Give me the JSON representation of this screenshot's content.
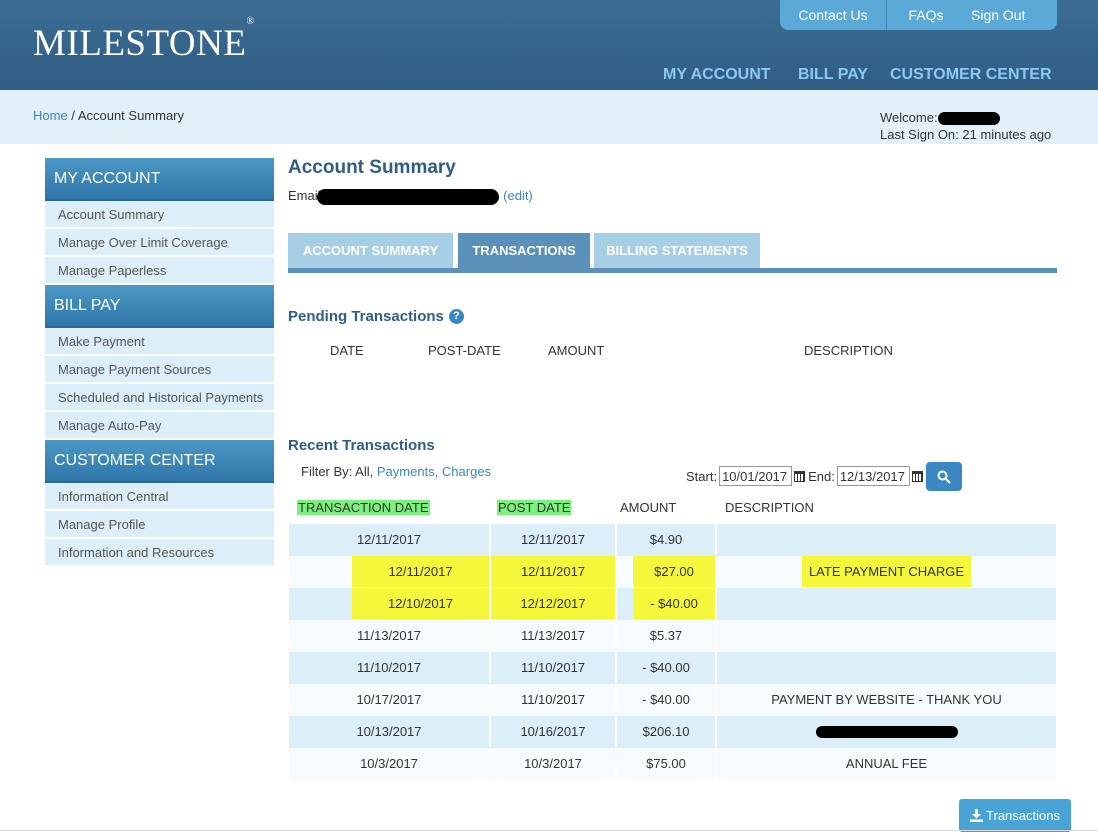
{
  "header": {
    "logo": "MILESTONE",
    "logo_mark": "®",
    "top_links": {
      "contact": "Contact Us",
      "faqs": "FAQs",
      "signout": "Sign Out"
    },
    "nav": {
      "my_account": "MY ACCOUNT",
      "bill_pay": "BILL PAY",
      "customer_center": "CUSTOMER CENTER"
    }
  },
  "breadcrumb": {
    "home": "Home",
    "separator": " / ",
    "current": "Account Summary"
  },
  "welcome": {
    "label": "Welcome:",
    "last_sign_on": "Last Sign On: 21 minutes ago"
  },
  "sidebar": {
    "my_account": {
      "title": "MY ACCOUNT",
      "items": [
        "Account Summary",
        "Manage Over Limit Coverage",
        "Manage Paperless"
      ]
    },
    "bill_pay": {
      "title": "BILL PAY",
      "items": [
        "Make Payment",
        "Manage Payment Sources",
        "Scheduled and Historical Payments",
        "Manage Auto-Pay"
      ]
    },
    "customer_center": {
      "title": "CUSTOMER CENTER",
      "items": [
        "Information Central",
        "Manage Profile",
        "Information and Resources"
      ]
    }
  },
  "main": {
    "title": "Account Summary",
    "email_label": "Email",
    "edit_link": "(edit)",
    "tabs": [
      "ACCOUNT SUMMARY",
      "TRANSACTIONS",
      "BILLING STATEMENTS"
    ],
    "pending": {
      "title": "Pending Transactions",
      "help": "?",
      "columns": [
        "DATE",
        "POST-DATE",
        "AMOUNT",
        "DESCRIPTION"
      ]
    },
    "recent": {
      "title": "Recent Transactions",
      "filter_label": "Filter By: All, ",
      "filter_payments": "Payments,",
      "filter_charges": "Charges",
      "start_label": "Start:",
      "start_value": "10/01/2017",
      "end_label": "End:",
      "end_value": "12/13/2017",
      "columns": [
        "TRANSACTION DATE",
        "POST DATE",
        "AMOUNT",
        "DESCRIPTION"
      ],
      "rows": [
        [
          "12/11/2017",
          "12/11/2017",
          "$4.90",
          ""
        ],
        [
          "12/11/2017",
          "12/11/2017",
          "$27.00",
          "LATE PAYMENT CHARGE"
        ],
        [
          "12/10/2017",
          "12/12/2017",
          "- $40.00",
          ""
        ],
        [
          "11/13/2017",
          "11/13/2017",
          "$5.37",
          ""
        ],
        [
          "11/10/2017",
          "11/10/2017",
          "- $40.00",
          ""
        ],
        [
          "10/17/2017",
          "11/10/2017",
          "- $40.00",
          "PAYMENT BY WEBSITE - THANK YOU"
        ],
        [
          "10/13/2017",
          "10/16/2017",
          "$206.10",
          ""
        ],
        [
          "10/3/2017",
          "10/3/2017",
          "$75.00",
          "ANNUAL FEE"
        ]
      ]
    },
    "download_button": "Transactions"
  },
  "colors": {
    "header": "#2f5d84",
    "accent": "#3a87c4",
    "highlight_yellow": "#f4f73a",
    "highlight_green": "#7cf07c"
  }
}
